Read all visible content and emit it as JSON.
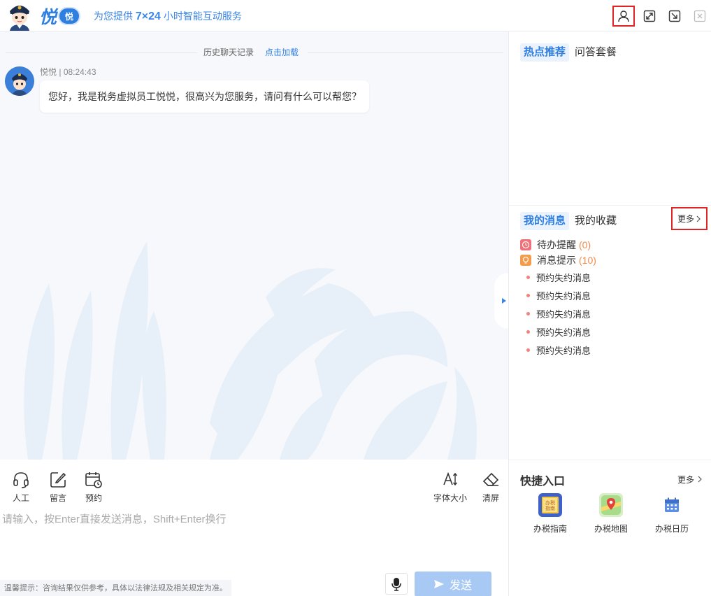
{
  "header": {
    "brand_char": "悦",
    "brand_badge": "悦",
    "tagline_pre": "为您提供 ",
    "tagline_bold": "7×24",
    "tagline_post": " 小时智能互动服务",
    "icons": [
      "user-icon",
      "expand-icon",
      "minimize-icon",
      "close-icon"
    ]
  },
  "chat": {
    "history_label": "历史聊天记录",
    "history_link": "点击加载",
    "messages": [
      {
        "sender": "悦悦",
        "time": "08:24:43",
        "text": "您好，我是税务虚拟员工悦悦，很高兴为您服务，请问有什么可以帮您？"
      }
    ]
  },
  "toolbar": {
    "left": [
      {
        "label": "人工",
        "icon": "headset-icon"
      },
      {
        "label": "留言",
        "icon": "edit-icon"
      },
      {
        "label": "预约",
        "icon": "calendar-clock-icon"
      }
    ],
    "right": [
      {
        "label": "字体大小",
        "icon": "font-size-icon"
      },
      {
        "label": "清屏",
        "icon": "eraser-icon"
      }
    ]
  },
  "input": {
    "placeholder": "请输入，按Enter直接发送消息，Shift+Enter换行",
    "tip": "温馨提示：咨询结果仅供参考，具体以法律法规及相关规定为准。",
    "send_label": "发送"
  },
  "right": {
    "hot_tabs": [
      "热点推荐",
      "问答套餐"
    ],
    "msg_tabs": [
      "我的消息",
      "我的收藏"
    ],
    "more_label": "更多",
    "todo": {
      "label": "待办提醒",
      "count": "(0)"
    },
    "notice": {
      "label": "消息提示",
      "count": "(10)"
    },
    "notice_items": [
      "预约失约消息",
      "预约失约消息",
      "预约失约消息",
      "预约失约消息",
      "预约失约消息"
    ],
    "quick_title": "快捷入口",
    "quick_more": "更多",
    "quick_items": [
      {
        "label": "办税指南",
        "icon": "guide-book-icon",
        "icon_text": "办税指南"
      },
      {
        "label": "办税地图",
        "icon": "map-pin-icon"
      },
      {
        "label": "办税日历",
        "icon": "calendar-icon"
      }
    ]
  },
  "colors": {
    "accent": "#2f7fe0",
    "highlight": "#e02424",
    "send": "#a9c9f5",
    "count": "#f08a4b"
  }
}
